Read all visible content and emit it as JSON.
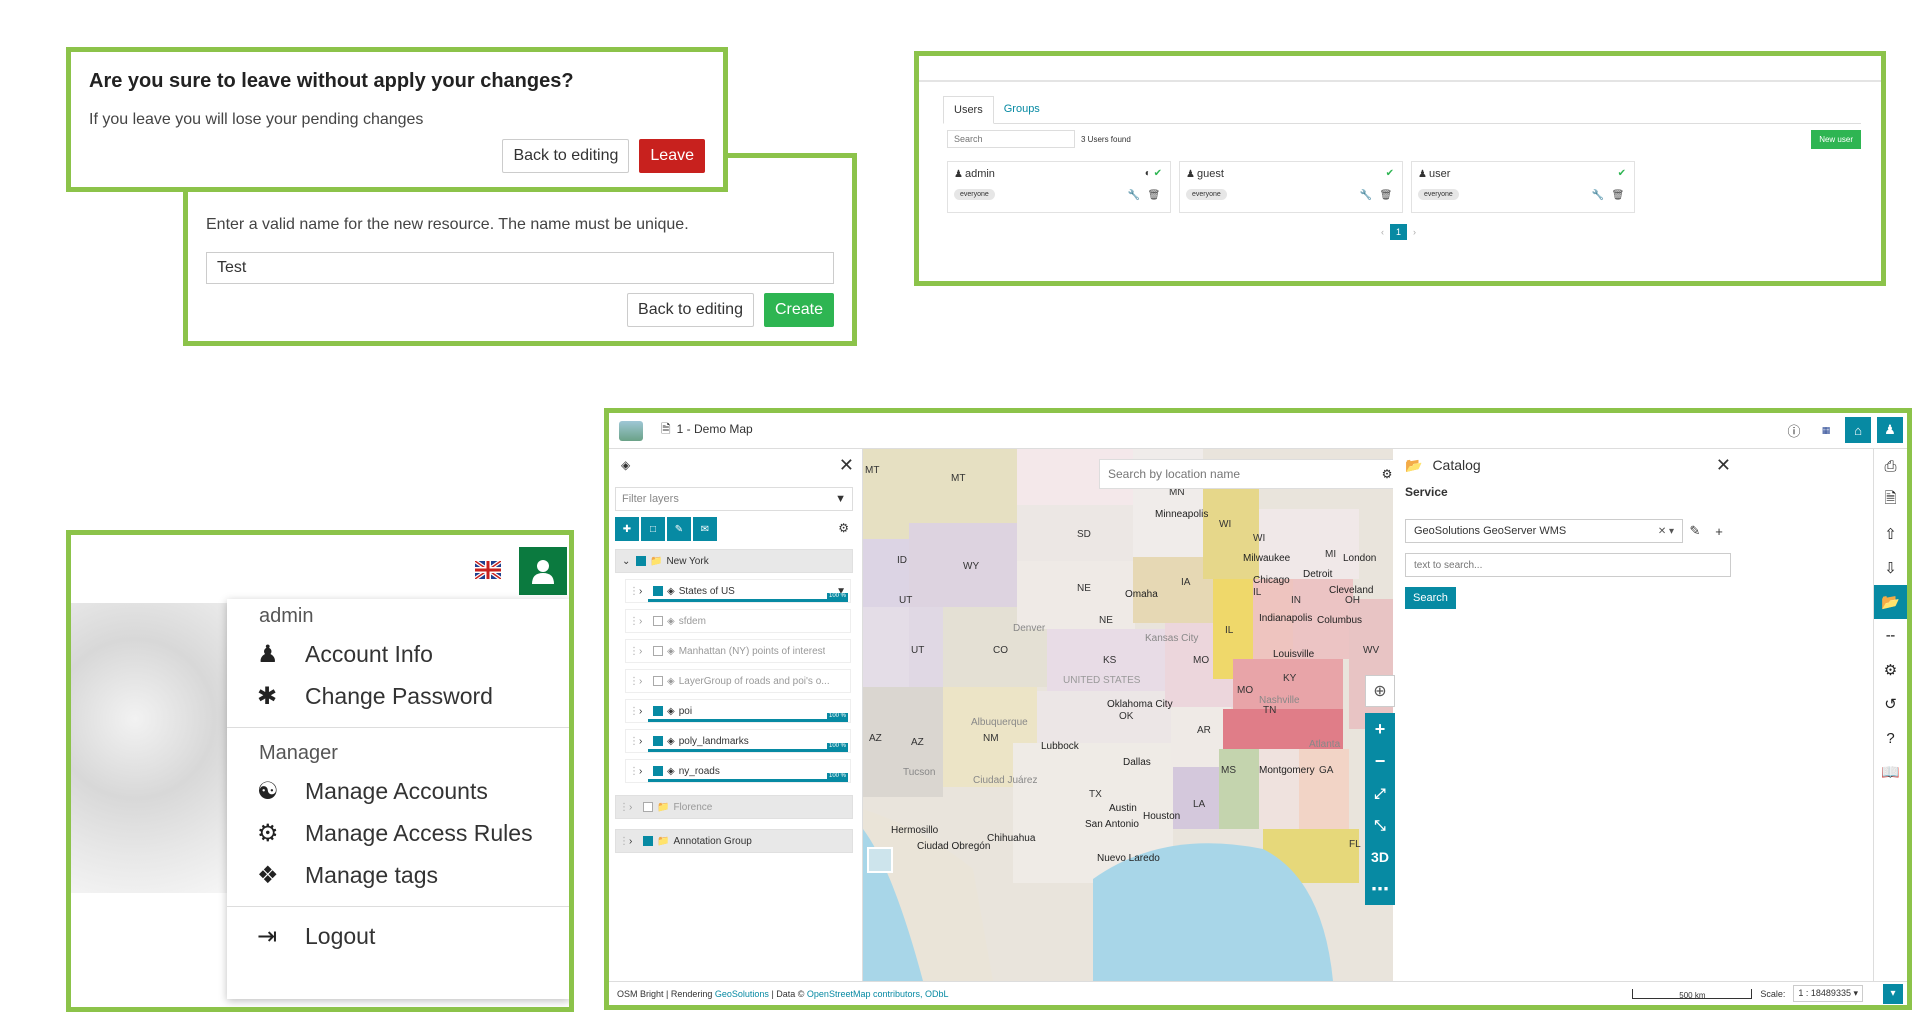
{
  "leave_dialog": {
    "title": "Are you sure to leave without apply your changes?",
    "body": "If you leave you will lose your pending changes",
    "back_label": "Back to editing",
    "leave_label": "Leave"
  },
  "create_dialog": {
    "body": "Enter a valid name for the new resource. The name must be unique.",
    "input_value": "Test",
    "back_label": "Back to editing",
    "create_label": "Create"
  },
  "users_panel": {
    "tabs": [
      "Users",
      "Groups"
    ],
    "search_placeholder": "Search",
    "found_text": "3 Users found",
    "new_user_label": "New user",
    "users": [
      {
        "name": "admin",
        "group": "everyone"
      },
      {
        "name": "guest",
        "group": "everyone"
      },
      {
        "name": "user",
        "group": "everyone"
      }
    ],
    "page": "1"
  },
  "account_menu": {
    "username": "admin",
    "items_user": [
      "Account Info",
      "Change Password"
    ],
    "manager_header": "Manager",
    "items_manager": [
      "Manage Accounts",
      "Manage Access Rules",
      "Manage tags"
    ],
    "logout": "Logout"
  },
  "map_viewer": {
    "map_name": "1 - Demo Map",
    "filter_placeholder": "Filter layers",
    "search_placeholder": "Search by location name",
    "group_name": "New York",
    "layers": [
      {
        "name": "States of US",
        "checked": true,
        "opacity": "100 %"
      },
      {
        "name": "sfdem",
        "checked": false
      },
      {
        "name": "Manhattan (NY) points of interest",
        "checked": false
      },
      {
        "name": "LayerGroup of roads and poi's o...",
        "checked": false
      },
      {
        "name": "poi",
        "checked": true,
        "opacity": "100 %"
      },
      {
        "name": "poly_landmarks",
        "checked": true,
        "opacity": "100 %"
      },
      {
        "name": "ny_roads",
        "checked": true,
        "opacity": "100 %"
      }
    ],
    "other_groups": [
      {
        "name": "Florence",
        "checked": false
      },
      {
        "name": "Annotation Group",
        "checked": true
      }
    ],
    "map_labels": [
      "MT",
      "MT",
      "ID",
      "WY",
      "SD",
      "MN",
      "WI",
      "WI",
      "MI",
      "NE",
      "NE",
      "IA",
      "IL",
      "IL",
      "IN",
      "OH",
      "UT",
      "UT",
      "CO",
      "KS",
      "MO",
      "MO",
      "KY",
      "AZ",
      "AZ",
      "NM",
      "OK",
      "AR",
      "TN",
      "MS",
      "GA",
      "TX",
      "LA",
      "FL",
      "WV"
    ],
    "city_labels": [
      "Minneapolis",
      "Milwaukee",
      "Detroit",
      "Chicago",
      "Cleveland",
      "Omaha",
      "Denver",
      "Kansas City",
      "Indianapolis",
      "Columbus",
      "Louisville",
      "Nashville",
      "Oklahoma City",
      "Albuquerque",
      "Lubbock",
      "Dallas",
      "Austin",
      "Houston",
      "San Antonio",
      "Hermosillo",
      "Chihuahua",
      "Ciudad Juárez",
      "Nuevo Laredo",
      "Ciudad Obregón",
      "Tucson",
      "Atlanta",
      "Montgomery",
      "London",
      "UNITED STATES"
    ],
    "zoom_3d": "3D",
    "catalog": {
      "title": "Catalog",
      "service_label": "Service",
      "service_value": "GeoSolutions GeoServer WMS",
      "text_placeholder": "text to search...",
      "search_label": "Search"
    },
    "footer": {
      "attribution_prefix": "OSM Bright | Rendering ",
      "attribution_geo": "GeoSolutions",
      "attribution_mid": " | Data © ",
      "attribution_osm": "OpenStreetMap contributors, ODbL",
      "scale_bar": "500 km",
      "scale_label": "Scale:",
      "scale_value": "1 : 18489335"
    }
  },
  "colors": {
    "panel_border": "#8cc34a",
    "accent": "#078aa3",
    "danger": "#c8211e",
    "success": "#2eb552",
    "account_green": "#0b7a3f"
  }
}
